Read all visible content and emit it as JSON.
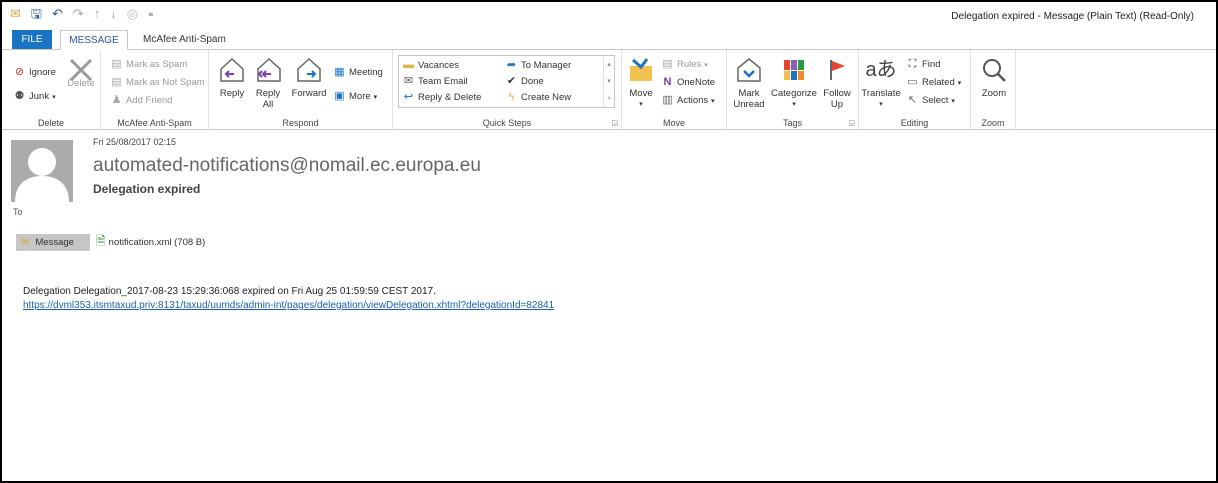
{
  "window": {
    "title": "Delegation expired - Message (Plain Text) (Read-Only)"
  },
  "quick_access": [
    {
      "icon": "envelope-icon"
    },
    {
      "icon": "save-icon"
    },
    {
      "icon": "undo-icon"
    },
    {
      "icon": "redo-icon"
    },
    {
      "icon": "up-arrow-icon"
    },
    {
      "icon": "down-arrow-icon"
    },
    {
      "icon": "circle-icon"
    },
    {
      "icon": "customize-qat-icon"
    }
  ],
  "tabs": {
    "file": "FILE",
    "message": "MESSAGE",
    "mcafee": "McAfee Anti-Spam"
  },
  "ribbon": {
    "delete": {
      "ignore": "Ignore",
      "junk": "Junk",
      "delete": "Delete",
      "label": "Delete"
    },
    "mcafee": {
      "mark_spam": "Mark as Spam",
      "mark_not_spam": "Mark as Not Spam",
      "add_friend": "Add Friend",
      "label": "McAfee Anti-Spam"
    },
    "respond": {
      "reply": "Reply",
      "reply_all_1": "Reply",
      "reply_all_2": "All",
      "forward": "Forward",
      "meeting": "Meeting",
      "more": "More",
      "label": "Respond"
    },
    "quick_steps": {
      "vacances": "Vacances",
      "team_email": "Team Email",
      "reply_delete": "Reply & Delete",
      "to_manager": "To Manager",
      "done": "Done",
      "create_new": "Create New",
      "label": "Quick Steps"
    },
    "move": {
      "move": "Move",
      "rules": "Rules",
      "onenote": "OneNote",
      "actions": "Actions",
      "label": "Move"
    },
    "tags": {
      "mark_unread_1": "Mark",
      "mark_unread_2": "Unread",
      "categorize": "Categorize",
      "follow_up_1": "Follow",
      "follow_up_2": "Up",
      "label": "Tags"
    },
    "editing": {
      "translate": "Translate",
      "find": "Find",
      "related": "Related",
      "select": "Select",
      "label": "Editing"
    },
    "zoom": {
      "zoom": "Zoom",
      "label": "Zoom"
    }
  },
  "message": {
    "date": "Fri 25/08/2017 02:15",
    "sender": "automated-notifications@nomail.ec.europa.eu",
    "subject": "Delegation expired",
    "to_label": "To",
    "message_tab": "Message",
    "attachment": "notification.xml (708 B)",
    "body_line1": "Delegation Delegation_2017-08-23 15:29:36:068 expired on Fri Aug 25 01:59:59 CEST 2017.",
    "body_link": "https://dvml353.itsmtaxud.priv:8131/taxud/uumds/admin-int/pages/delegation/viewDelegation.xhtml?delegationId=82841"
  },
  "colors": {
    "accent": "#1a73c4",
    "link": "#1a5fb4",
    "avatar": "#ababab",
    "flag": "#e8452c"
  }
}
